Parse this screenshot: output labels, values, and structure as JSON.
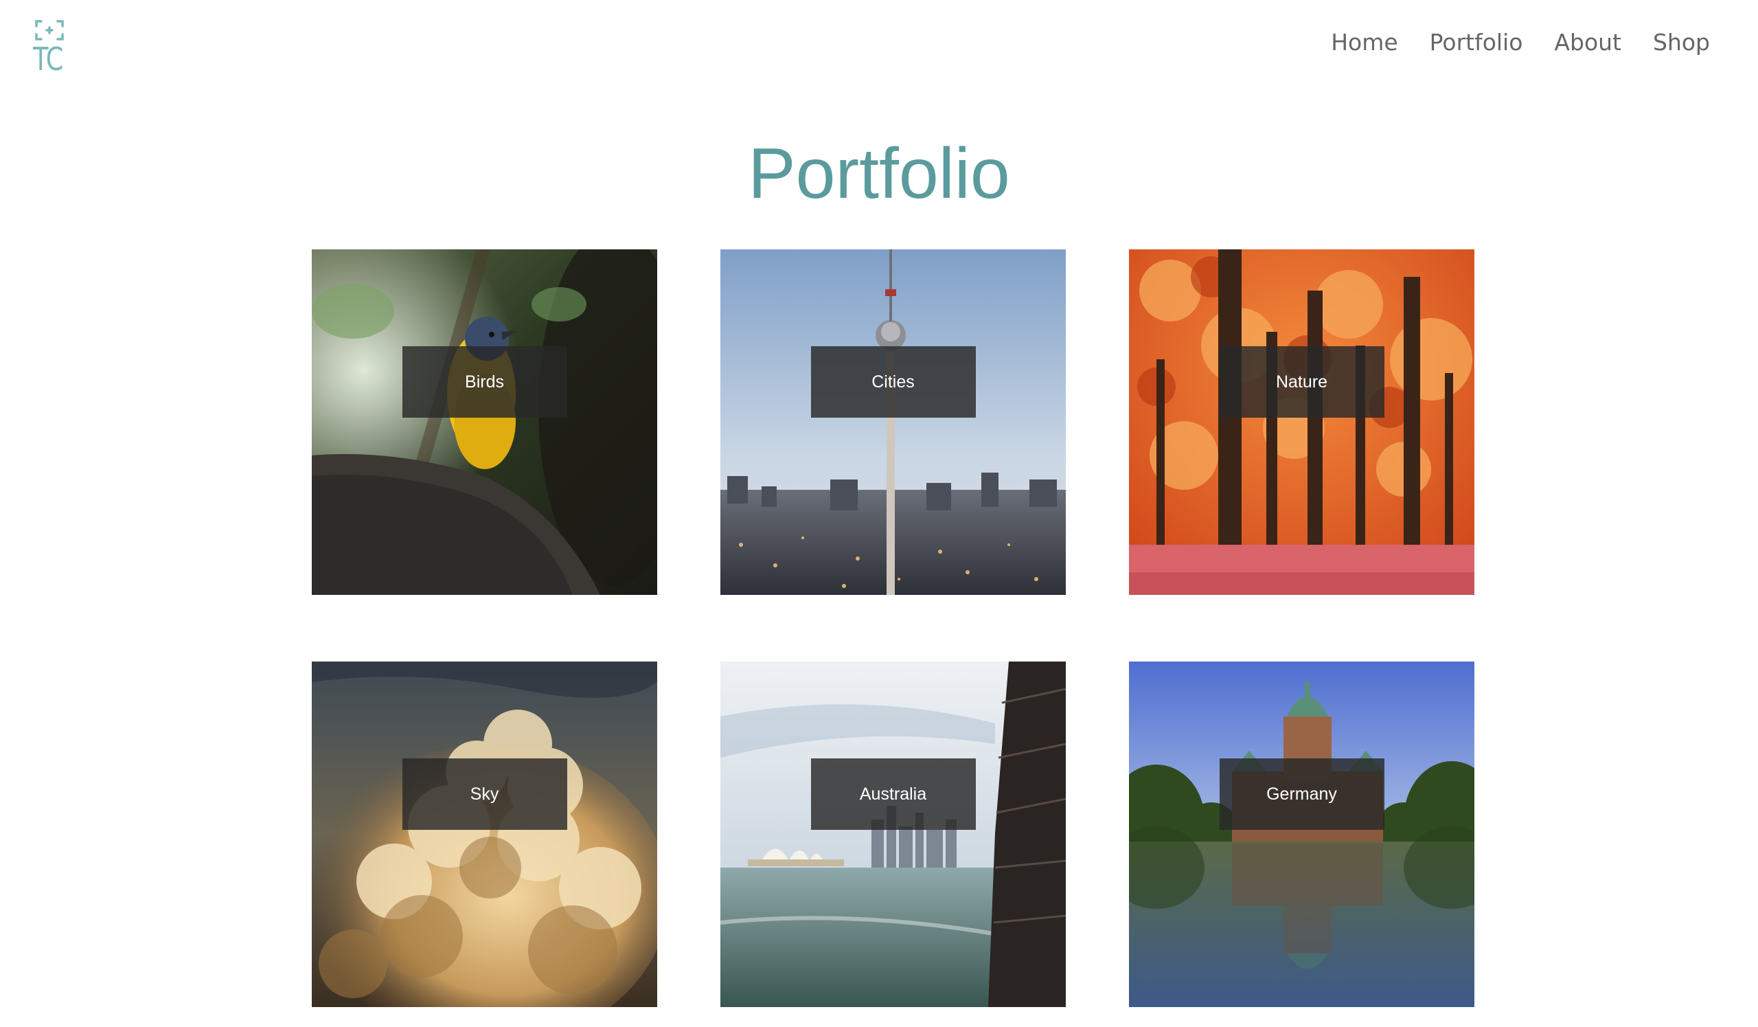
{
  "logo": {
    "text": "TC",
    "icon": "camera-focus-icon"
  },
  "nav": {
    "items": [
      {
        "label": "Home"
      },
      {
        "label": "Portfolio"
      },
      {
        "label": "About"
      },
      {
        "label": "Shop"
      }
    ]
  },
  "page": {
    "title": "Portfolio"
  },
  "gallery": {
    "tiles": [
      {
        "label": "Birds"
      },
      {
        "label": "Cities"
      },
      {
        "label": "Nature"
      },
      {
        "label": "Sky"
      },
      {
        "label": "Australia"
      },
      {
        "label": "Germany"
      }
    ]
  },
  "colors": {
    "accent": "#5b9b9d",
    "logo": "#7ab8b8",
    "nav_text": "#666666",
    "caption_bg": "#282828"
  }
}
